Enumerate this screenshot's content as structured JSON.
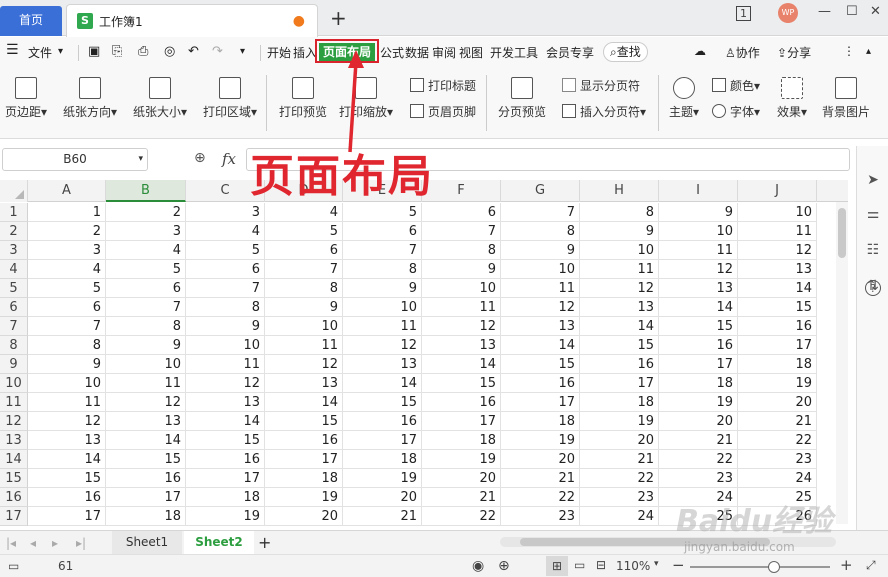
{
  "titlebar": {
    "home_tab": "首页",
    "doc_tab_icon": "S",
    "doc_tab_name": "工作簿1",
    "unsaved_dot": "●",
    "new_tab": "+",
    "page_indicator": "1",
    "avatar": "WP",
    "min": "—",
    "max": "☐",
    "close": "✕"
  },
  "menubar": {
    "file": "文件",
    "tabs": [
      "开始",
      "插入",
      "页面布局",
      "公式",
      "数据",
      "审阅",
      "视图",
      "开发工具",
      "会员专享"
    ],
    "active_tab": "页面布局",
    "search": "查找",
    "collab": "协作",
    "share": "分享"
  },
  "ribbon": {
    "margins": "页边距",
    "orientation": "纸张方向",
    "size": "纸张大小",
    "print_area": "打印区域",
    "print_preview": "打印预览",
    "print_scale": "打印缩放",
    "print_titles": "打印标题",
    "header_footer": "页眉页脚",
    "page_break_preview": "分页预览",
    "show_page_breaks": "显示分页符",
    "insert_page_break": "插入分页符",
    "theme": "主题",
    "colors": "颜色",
    "fonts": "字体",
    "effects": "效果",
    "background": "背景图片"
  },
  "formula_bar": {
    "name_box": "B60",
    "fx": "fx",
    "value": ""
  },
  "annotation": "页面布局",
  "sheet": {
    "columns": [
      "A",
      "B",
      "C",
      "D",
      "E",
      "F",
      "G",
      "H",
      "I",
      "J"
    ],
    "selected_column": "B",
    "rows": [
      {
        "n": "1",
        "v": [
          "1",
          "2",
          "3",
          "4",
          "5",
          "6",
          "7",
          "8",
          "9",
          "10"
        ]
      },
      {
        "n": "2",
        "v": [
          "2",
          "3",
          "4",
          "5",
          "6",
          "7",
          "8",
          "9",
          "10",
          "11"
        ]
      },
      {
        "n": "3",
        "v": [
          "3",
          "4",
          "5",
          "6",
          "7",
          "8",
          "9",
          "10",
          "11",
          "12"
        ]
      },
      {
        "n": "4",
        "v": [
          "4",
          "5",
          "6",
          "7",
          "8",
          "9",
          "10",
          "11",
          "12",
          "13"
        ]
      },
      {
        "n": "5",
        "v": [
          "5",
          "6",
          "7",
          "8",
          "9",
          "10",
          "11",
          "12",
          "13",
          "14"
        ]
      },
      {
        "n": "6",
        "v": [
          "6",
          "7",
          "8",
          "9",
          "10",
          "11",
          "12",
          "13",
          "14",
          "15"
        ]
      },
      {
        "n": "7",
        "v": [
          "7",
          "8",
          "9",
          "10",
          "11",
          "12",
          "13",
          "14",
          "15",
          "16"
        ]
      },
      {
        "n": "8",
        "v": [
          "8",
          "9",
          "10",
          "11",
          "12",
          "13",
          "14",
          "15",
          "16",
          "17"
        ]
      },
      {
        "n": "9",
        "v": [
          "9",
          "10",
          "11",
          "12",
          "13",
          "14",
          "15",
          "16",
          "17",
          "18"
        ]
      },
      {
        "n": "10",
        "v": [
          "10",
          "11",
          "12",
          "13",
          "14",
          "15",
          "16",
          "17",
          "18",
          "19"
        ]
      },
      {
        "n": "11",
        "v": [
          "11",
          "12",
          "13",
          "14",
          "15",
          "16",
          "17",
          "18",
          "19",
          "20"
        ]
      },
      {
        "n": "12",
        "v": [
          "12",
          "13",
          "14",
          "15",
          "16",
          "17",
          "18",
          "19",
          "20",
          "21"
        ]
      },
      {
        "n": "13",
        "v": [
          "13",
          "14",
          "15",
          "16",
          "17",
          "18",
          "19",
          "20",
          "21",
          "22"
        ]
      },
      {
        "n": "14",
        "v": [
          "14",
          "15",
          "16",
          "17",
          "18",
          "19",
          "20",
          "21",
          "22",
          "23"
        ]
      },
      {
        "n": "15",
        "v": [
          "15",
          "16",
          "17",
          "18",
          "19",
          "20",
          "21",
          "22",
          "23",
          "24"
        ]
      },
      {
        "n": "16",
        "v": [
          "16",
          "17",
          "18",
          "19",
          "20",
          "21",
          "22",
          "23",
          "24",
          "25"
        ]
      },
      {
        "n": "17",
        "v": [
          "17",
          "18",
          "19",
          "20",
          "21",
          "22",
          "23",
          "24",
          "25",
          "26"
        ]
      }
    ]
  },
  "sheets": {
    "tabs": [
      "Sheet1",
      "Sheet2"
    ],
    "active": "Sheet2",
    "add": "+"
  },
  "status": {
    "count": "61",
    "zoom": "110%",
    "zoom_minus": "−",
    "zoom_plus": "+",
    "zoom_level": 0.6
  },
  "watermark": "Baidu经验",
  "watermark_url": "jingyan.baidu.com",
  "colors": {
    "accent_green": "#2c9e3f",
    "highlight_red": "#d9232d",
    "home_blue": "#3a6fd8"
  }
}
